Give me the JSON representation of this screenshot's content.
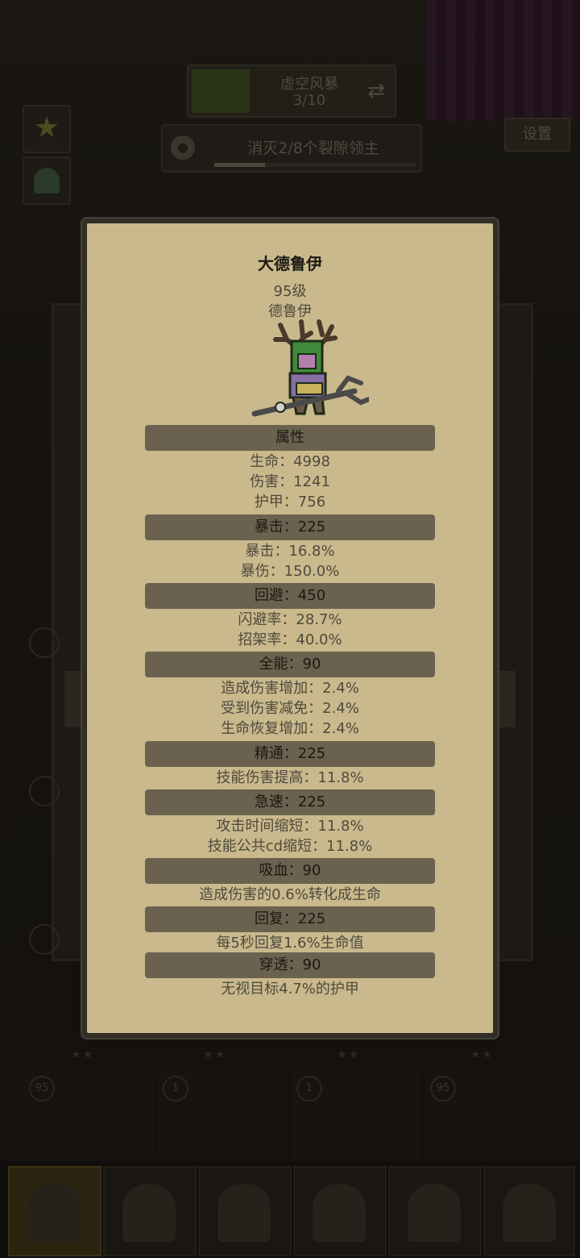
{
  "background": {
    "stage_name": "虚空风暴",
    "stage_progress": "3/10",
    "quest_text": "消灭2/8个裂隙领主",
    "quest_progress": 0.25,
    "settings_label": "设置",
    "hero_levels": [
      "95",
      "1",
      "1",
      "95"
    ]
  },
  "modal": {
    "name": "大德鲁伊",
    "level": "95级",
    "class": "德鲁伊",
    "sections": [
      {
        "title": "属性",
        "lines": [
          "生命：4998",
          "伤害：1241",
          "护甲：756"
        ]
      },
      {
        "title": "暴击：225",
        "lines": [
          "暴击：16.8%",
          "暴伤：150.0%"
        ]
      },
      {
        "title": "回避：450",
        "lines": [
          "闪避率：28.7%",
          "招架率：40.0%"
        ]
      },
      {
        "title": "全能：90",
        "lines": [
          "造成伤害增加：2.4%",
          "受到伤害减免：2.4%",
          "生命恢复增加：2.4%"
        ]
      },
      {
        "title": "精通：225",
        "lines": [
          "技能伤害提高：11.8%"
        ]
      },
      {
        "title": "急速：225",
        "lines": [
          "攻击时间缩短：11.8%",
          "技能公共cd缩短：11.8%"
        ]
      },
      {
        "title": "吸血：90",
        "lines": [
          "造成伤害的0.6%转化成生命"
        ]
      },
      {
        "title": "回复：225",
        "lines": [
          "每5秒回复1.6%生命值"
        ]
      },
      {
        "title": "穿透：90",
        "lines": [
          "无视目标4.7%的护甲"
        ]
      }
    ]
  },
  "colors": {
    "modal_bg": "#c9b98c",
    "section_bar": "#6a624f",
    "frame": "#322e26"
  }
}
